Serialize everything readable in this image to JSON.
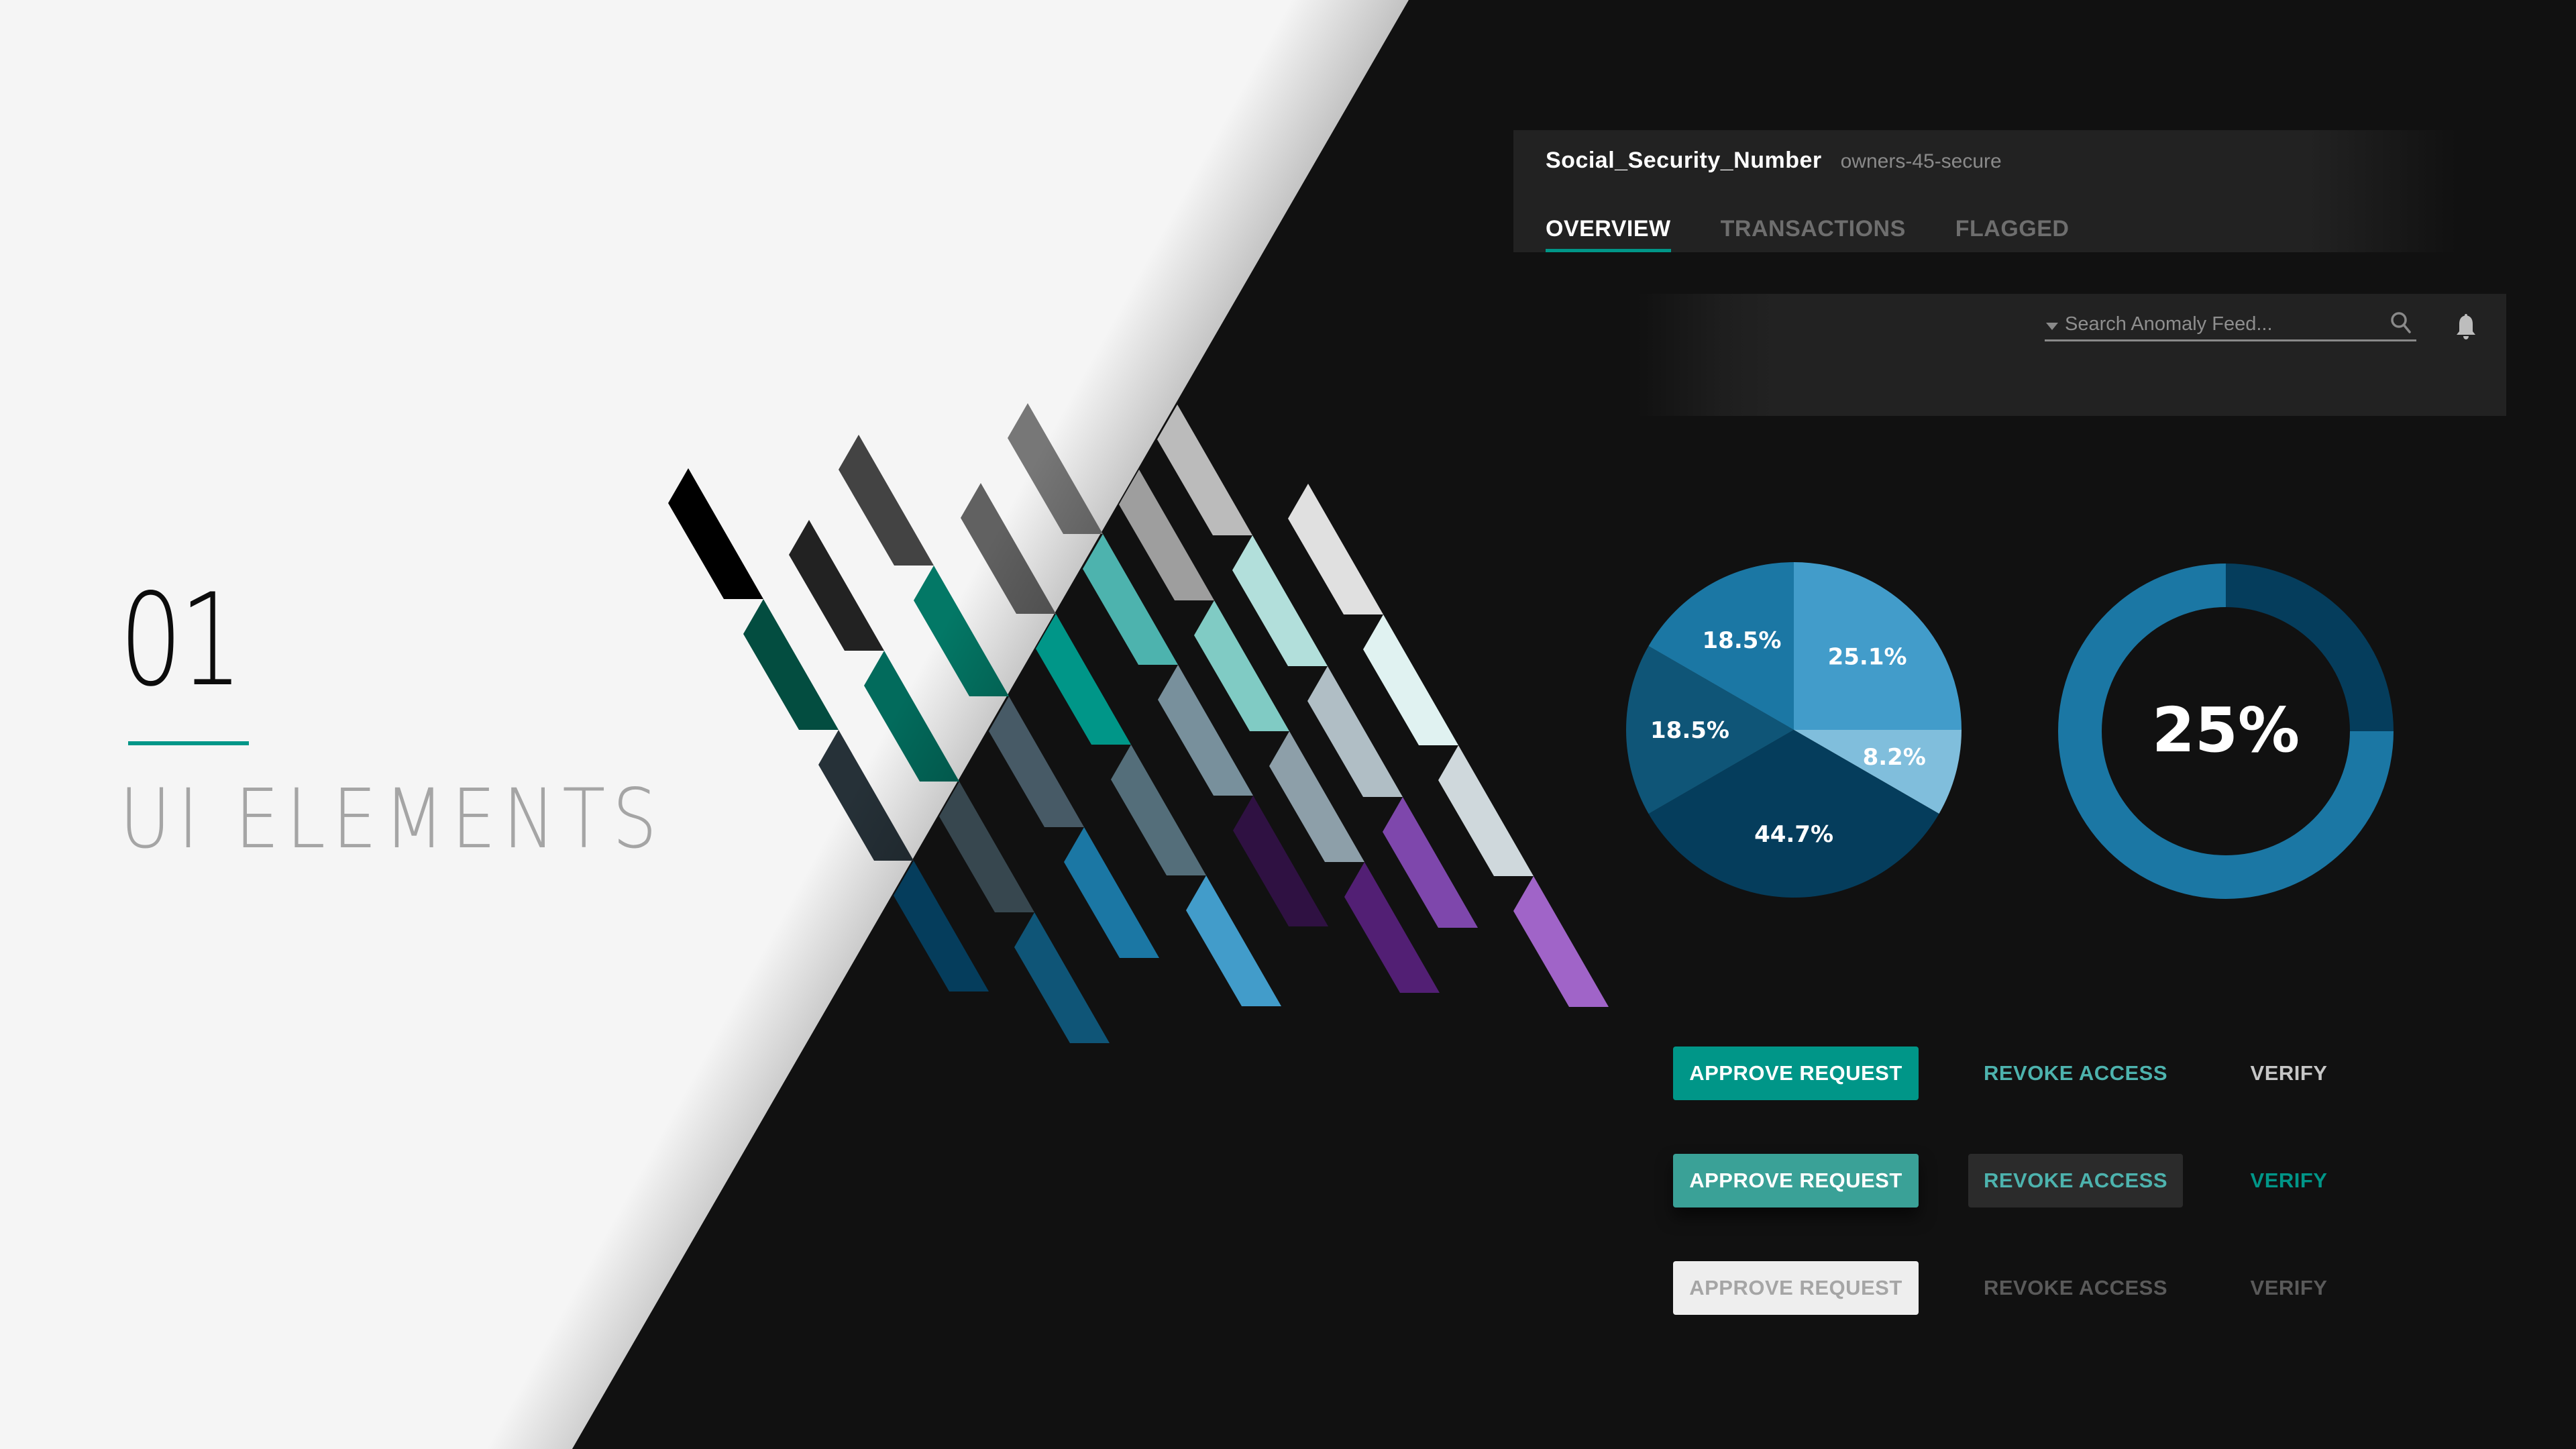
{
  "slide": {
    "section_number": "01",
    "section_title": "UI ELEMENTS",
    "colors": {
      "light_bg": "#f5f5f5",
      "dark_bg": "#111111",
      "accent": "#009688"
    }
  },
  "decor": {
    "stripe_columns": [
      [
        "#000000",
        "#034d40",
        "#263138",
        "#053d5c"
      ],
      [
        "#222222",
        "#026b5c",
        "#37474f",
        "#0f5577"
      ],
      [
        "#434343",
        "#037866",
        "#475a66",
        "#1b77a4"
      ],
      [
        "#616161",
        "#009688",
        "#546e7a",
        "#429cca"
      ],
      [
        "#777777",
        "#4db3ae",
        "#78909c",
        "#2f1142"
      ],
      [
        "#9e9e9e",
        "#80cbc4",
        "#8d9fa9",
        "#521f74"
      ],
      [
        "#bbbbbb",
        "#b2dfdb",
        "#b0bec5",
        "#7e47ac"
      ],
      [
        "#e0e0e0",
        "#e0f2f1",
        "#cfd8dc",
        "#a064c8"
      ]
    ]
  },
  "header": {
    "title": "Social_Security_Number",
    "subtitle": "owners-45-secure",
    "tabs": [
      {
        "label": "OVERVIEW",
        "active": true
      },
      {
        "label": "TRANSACTIONS",
        "active": false
      },
      {
        "label": "FLAGGED",
        "active": false
      }
    ]
  },
  "search": {
    "placeholder": "Search Anomaly Feed...",
    "value": "",
    "icon": "search-icon",
    "notifications_icon": "bell-icon"
  },
  "chart_data": [
    {
      "type": "pie",
      "title": "",
      "start": "12 o'clock, clockwise",
      "slices": [
        {
          "label": "25.1%",
          "value": 25.1,
          "rendered_share": 0.25,
          "color": "#429cca"
        },
        {
          "label": "8.2%",
          "value": 8.2,
          "rendered_share": 0.0833,
          "color": "#80bedc"
        },
        {
          "label": "44.7%",
          "value": 44.7,
          "rendered_share": 0.3333,
          "color": "#053d5c"
        },
        {
          "label": "18.5%",
          "value": 18.5,
          "rendered_share": 0.1667,
          "color": "#0f5577"
        },
        {
          "label": "18.5%",
          "value": 18.5,
          "rendered_share": 0.1667,
          "color": "#1b77a4"
        }
      ]
    },
    {
      "type": "pie",
      "variant": "donut",
      "center_label": "25%",
      "value": 25,
      "max": 100,
      "value_color": "#053d5c",
      "remainder_color": "#1b77a4"
    }
  ],
  "buttons": {
    "rows": [
      {
        "state": "default",
        "primary": "APPROVE REQUEST",
        "secondary": "REVOKE ACCESS",
        "tertiary": "VERIFY"
      },
      {
        "state": "hover",
        "primary": "APPROVE REQUEST",
        "secondary": "REVOKE ACCESS",
        "tertiary": "VERIFY"
      },
      {
        "state": "disabled",
        "primary": "APPROVE REQUEST",
        "secondary": "REVOKE ACCESS",
        "tertiary": "VERIFY"
      }
    ]
  }
}
